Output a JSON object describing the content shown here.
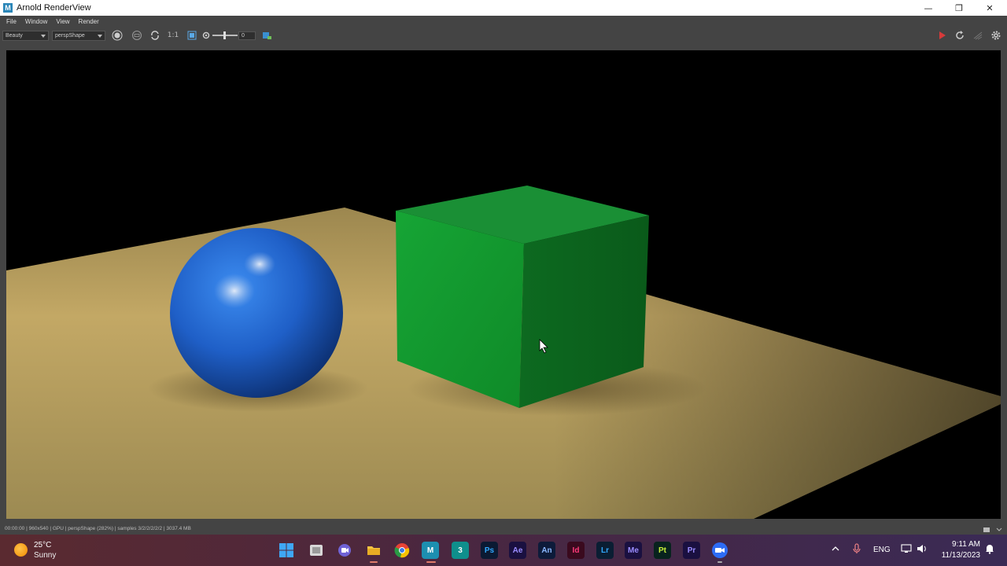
{
  "window": {
    "app_icon": "M",
    "title": "Arnold RenderView",
    "minimize": "—",
    "maximize": "❐",
    "close": "✕"
  },
  "menu": {
    "items": [
      "File",
      "Window",
      "View",
      "Render"
    ]
  },
  "toolbar": {
    "aov_value": "Beauty",
    "camera_value": "perspShape",
    "ratio_label": "1:1",
    "exposure_value": "0"
  },
  "status": {
    "text": "00:00:00 | 960x540 | GPU | perspShape (282%) | samples 3/2/2/2/2/2 | 3037.4 MB"
  },
  "weather": {
    "temp": "25°C",
    "desc": "Sunny"
  },
  "taskbar": {
    "apps": [
      {
        "name": "windows-start",
        "label": ""
      },
      {
        "name": "file-manager",
        "label": ""
      },
      {
        "name": "teams",
        "label": ""
      },
      {
        "name": "file-explorer",
        "label": ""
      },
      {
        "name": "chrome",
        "label": ""
      },
      {
        "name": "maya",
        "label": "M"
      },
      {
        "name": "3ds-max",
        "label": "3"
      },
      {
        "name": "photoshop",
        "label": "Ps"
      },
      {
        "name": "after-effects",
        "label": "Ae"
      },
      {
        "name": "animate",
        "label": "An"
      },
      {
        "name": "indesign",
        "label": "Id"
      },
      {
        "name": "lightroom",
        "label": "Lr"
      },
      {
        "name": "media-encoder",
        "label": "Me"
      },
      {
        "name": "substance-painter",
        "label": "Pt"
      },
      {
        "name": "premiere",
        "label": "Pr"
      },
      {
        "name": "zoom",
        "label": ""
      }
    ]
  },
  "tray": {
    "language": "ENG",
    "time": "9:11 AM",
    "date": "11/13/2023"
  },
  "colors": {
    "sphere": "#1f5fc7",
    "cube_front": "#139a2d",
    "cube_side": "#0e6e21",
    "cube_top": "#1a8a33",
    "floor": "#c9ad6a"
  }
}
